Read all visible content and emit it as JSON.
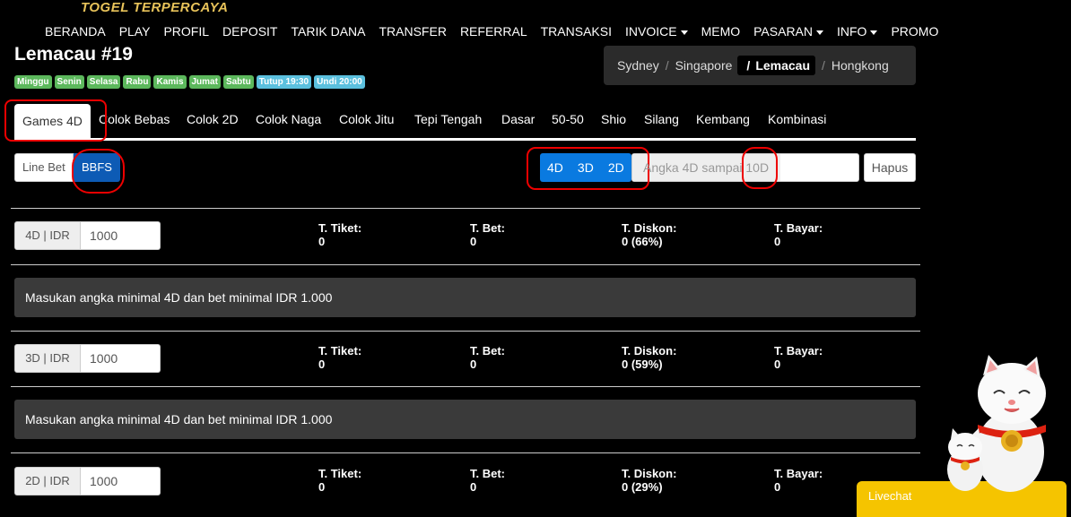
{
  "header": {
    "logo_text": "TOGEL TERPERCAYA"
  },
  "nav": [
    {
      "label": "BERANDA",
      "dropdown": false
    },
    {
      "label": "PLAY",
      "dropdown": false
    },
    {
      "label": "PROFIL",
      "dropdown": false
    },
    {
      "label": "DEPOSIT",
      "dropdown": false
    },
    {
      "label": "TARIK DANA",
      "dropdown": false
    },
    {
      "label": "TRANSFER",
      "dropdown": false
    },
    {
      "label": "REFERRAL",
      "dropdown": false
    },
    {
      "label": "TRANSAKSI",
      "dropdown": false
    },
    {
      "label": "INVOICE",
      "dropdown": true
    },
    {
      "label": "MEMO",
      "dropdown": false
    },
    {
      "label": "PASARAN",
      "dropdown": true
    },
    {
      "label": "INFO",
      "dropdown": true
    },
    {
      "label": "PROMO",
      "dropdown": false
    }
  ],
  "page_title": "Lemacau #19",
  "days": [
    {
      "label": "Minggu",
      "type": "success"
    },
    {
      "label": "Senin",
      "type": "success"
    },
    {
      "label": "Selasa",
      "type": "success"
    },
    {
      "label": "Rabu",
      "type": "success"
    },
    {
      "label": "Kamis",
      "type": "success"
    },
    {
      "label": "Jumat",
      "type": "success"
    },
    {
      "label": "Sabtu",
      "type": "success"
    },
    {
      "label": "Tutup 19:30",
      "type": "info"
    },
    {
      "label": "Undi 20:00",
      "type": "info"
    }
  ],
  "breadcrumb": {
    "items": [
      "Sydney",
      "Singapore"
    ],
    "active": "Lemacau",
    "after": "Hongkong"
  },
  "tabs": [
    "Games 4D",
    "Colok Bebas",
    "Colok 2D",
    "Colok Naga",
    "Colok Jitu",
    "Tepi Tengah",
    "Dasar",
    "50-50",
    "Shio",
    "Silang",
    "Kembang",
    "Kombinasi"
  ],
  "mode": {
    "line_bet": "Line Bet",
    "bbfs": "BBFS"
  },
  "digits": [
    "4D",
    "3D",
    "2D"
  ],
  "angka_placeholder": "Angka 4D sampai 10D",
  "hapus_label": "Hapus",
  "rows": [
    {
      "bet_label": "4D | IDR",
      "bet_value": "1000",
      "tiket_label": "T. Tiket:",
      "tiket": "0",
      "bet_total_label": "T. Bet:",
      "bet_total": "0",
      "diskon_label": "T. Diskon:",
      "diskon": "0 (66%)",
      "bayar_label": "T. Bayar:",
      "bayar": "0",
      "message": "Masukan angka minimal 4D dan bet minimal IDR 1.000"
    },
    {
      "bet_label": "3D | IDR",
      "bet_value": "1000",
      "tiket_label": "T. Tiket:",
      "tiket": "0",
      "bet_total_label": "T. Bet:",
      "bet_total": "0",
      "diskon_label": "T. Diskon:",
      "diskon": "0 (59%)",
      "bayar_label": "T. Bayar:",
      "bayar": "0",
      "message": "Masukan angka minimal 4D dan bet minimal IDR 1.000"
    },
    {
      "bet_label": "2D | IDR",
      "bet_value": "1000",
      "tiket_label": "T. Tiket:",
      "tiket": "0",
      "bet_total_label": "T. Bet:",
      "bet_total": "0",
      "diskon_label": "T. Diskon:",
      "diskon": "0 (29%)",
      "bayar_label": "T. Bayar:",
      "bayar": "0"
    }
  ],
  "livechat_label": "Livechat",
  "colors": {
    "success": "#5cb85c",
    "info": "#5bc0de",
    "primary": "#0a7ae0",
    "bbfs": "#0d5bb5",
    "livechat": "#f5c400"
  }
}
